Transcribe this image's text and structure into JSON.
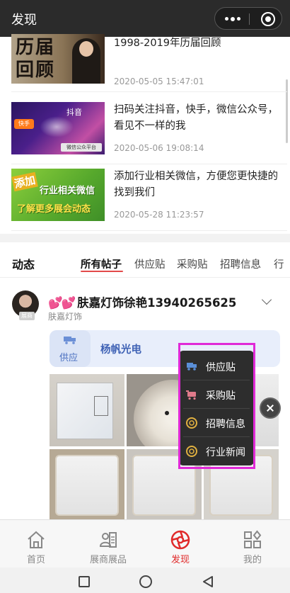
{
  "app": {
    "title": "发现"
  },
  "articles": [
    {
      "title": "1998-2019年历届回顾",
      "date": "2020-05-05 15:47:01",
      "thumb_text": "历届回顾"
    },
    {
      "title": "扫码关注抖音，快手，微信公众号，看见不一样的我",
      "date": "2020-05-06 19:08:14",
      "thumb_tiktok": "抖音",
      "thumb_kuaishou": "快手",
      "thumb_wechat": "微信公众平台"
    },
    {
      "title": "添加行业相关微信，方便您更快捷的找到我们",
      "date": "2020-05-28 11:23:57",
      "thumb_line1": "添加",
      "thumb_line2": "行业相关微信",
      "thumb_line3": "了解更多展会动态"
    }
  ],
  "feed": {
    "section_title": "动态",
    "tabs": [
      "所有帖子",
      "供应贴",
      "采购贴",
      "招聘信息",
      "行"
    ],
    "active_tab": "所有帖子",
    "post": {
      "author": "肤嘉灯饰徐艳13940265625",
      "author_prefix": "💕💕",
      "subtitle": "肤嘉灯饰",
      "avatar_badge": "展商",
      "card_label": "供应",
      "card_company": "杨帆光电"
    }
  },
  "popup_menu": {
    "items": [
      {
        "label": "供应贴",
        "icon": "truck-icon",
        "color": "#5a8fd8"
      },
      {
        "label": "采购贴",
        "icon": "cart-icon",
        "color": "#e07a8a"
      },
      {
        "label": "招聘信息",
        "icon": "aperture-icon",
        "color": "#e0b040"
      },
      {
        "label": "行业新闻",
        "icon": "aperture-icon",
        "color": "#e0b040"
      }
    ]
  },
  "tabbar": {
    "items": [
      {
        "label": "首页",
        "icon": "home-icon"
      },
      {
        "label": "展商展品",
        "icon": "exhibitor-icon"
      },
      {
        "label": "发现",
        "icon": "discover-icon",
        "active": true
      },
      {
        "label": "我的",
        "icon": "grid-icon"
      }
    ],
    "active_color": "#e02a2a"
  },
  "highlight_color": "#e029d7"
}
